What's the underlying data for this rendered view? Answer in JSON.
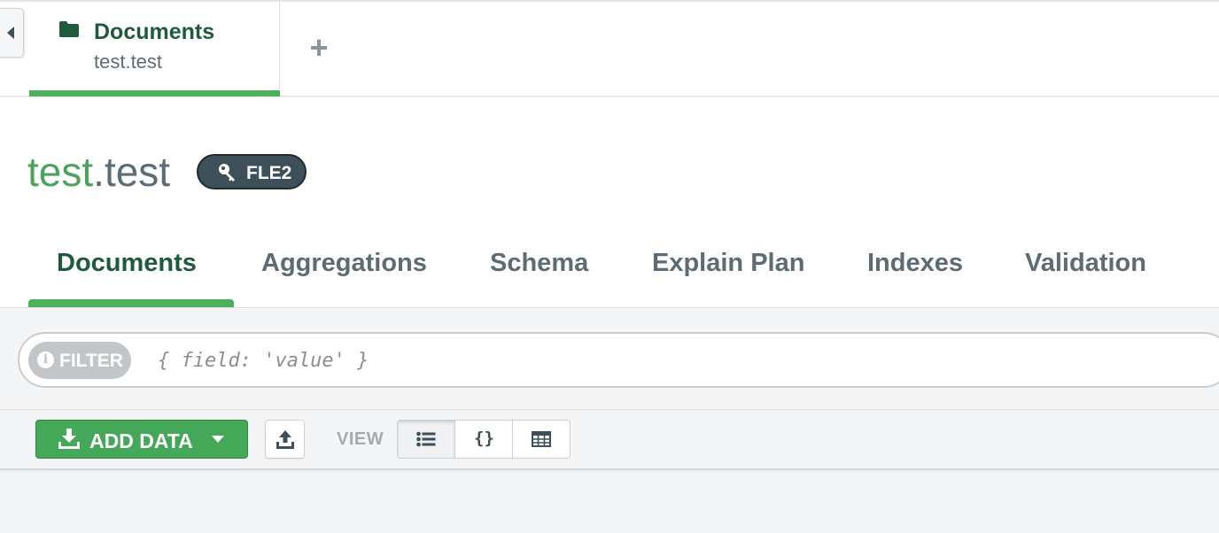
{
  "workspace_tabs": {
    "active": {
      "icon": "folder-icon",
      "title": "Documents",
      "subtitle": "test.test"
    },
    "add_tab": "+"
  },
  "collection": {
    "db_name": "test",
    "separator": ".",
    "collection_name": "test",
    "badge": {
      "icon": "key-icon",
      "label": "FLE2"
    }
  },
  "sub_tabs": [
    "Documents",
    "Aggregations",
    "Schema",
    "Explain Plan",
    "Indexes",
    "Validation"
  ],
  "query_bar": {
    "filter_label": "FILTER",
    "info_icon": "i",
    "filter_placeholder": "{ field: 'value' }",
    "filter_value": ""
  },
  "toolbar": {
    "add_data_label": "ADD DATA",
    "view_label": "VIEW",
    "view_json_glyph": "{}",
    "view_modes": [
      "list",
      "json",
      "table"
    ],
    "active_view": "list"
  },
  "colors": {
    "accent_green": "#4db05b",
    "dark_green_text": "#1f5a3c",
    "slate": "#3d4f58",
    "muted_text": "#5d6c74"
  }
}
